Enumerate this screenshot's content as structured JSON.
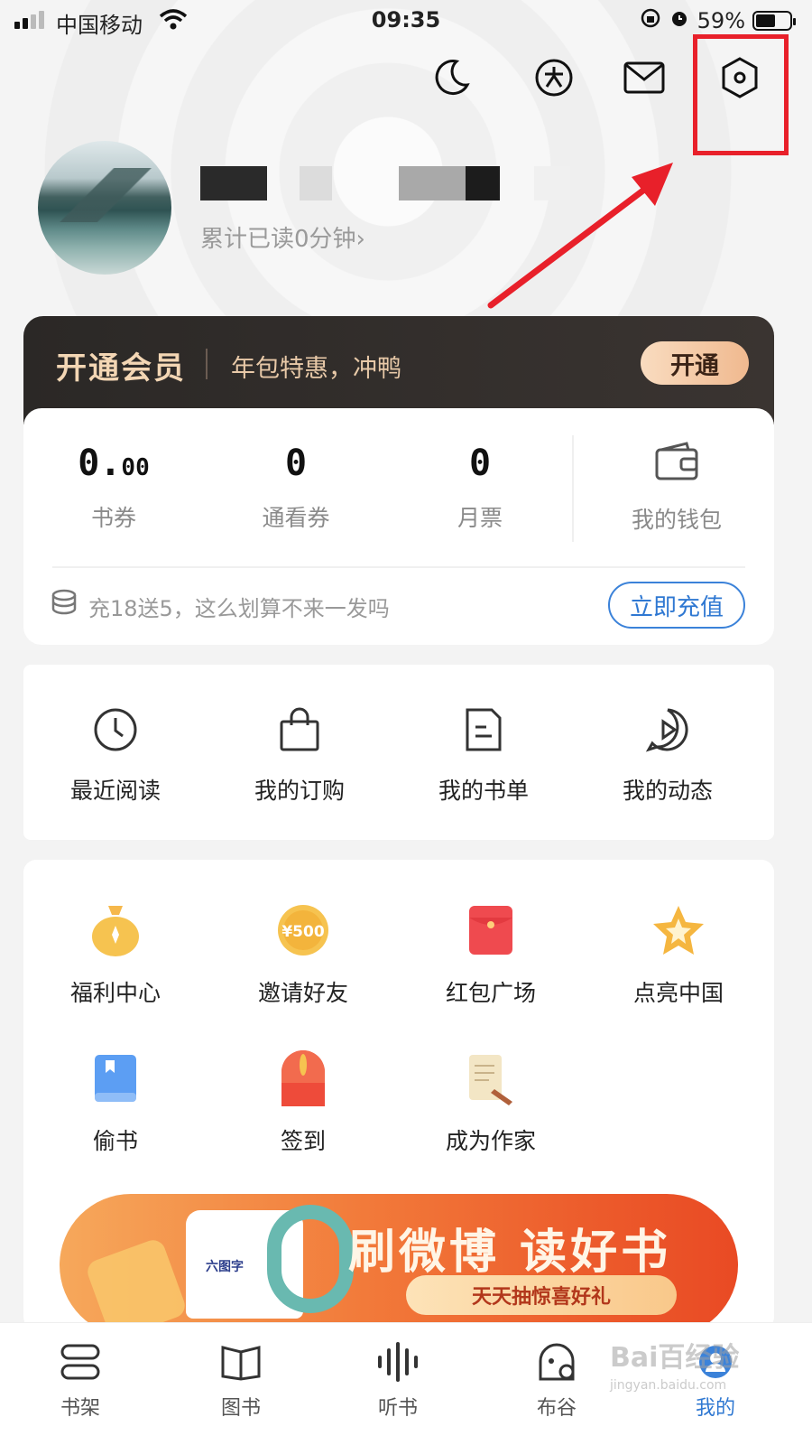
{
  "status_bar": {
    "carrier": "中国移动",
    "time": "09:35",
    "battery": "59%",
    "battery_level": 0.59
  },
  "header": {
    "icons": [
      "moon-icon",
      "pace-icon",
      "mail-icon",
      "settings-icon"
    ]
  },
  "profile": {
    "read_time": "累计已读0分钟",
    "chevron": "›"
  },
  "vip": {
    "title": "开通会员",
    "subtitle": "年包特惠，冲鸭",
    "button": "开通",
    "colors": {
      "title": "#f3d6b4",
      "background": "#2b2826"
    }
  },
  "wallet": {
    "stats": [
      {
        "value": "0.",
        "value_small": "00",
        "label": "书券"
      },
      {
        "value": "0",
        "label": "通看券"
      },
      {
        "value": "0",
        "label": "月票"
      }
    ],
    "wallet_label": "我的钱包",
    "promo": "充18送5，这么划算不来一发吗",
    "recharge_button": "立即充值"
  },
  "shortcuts": [
    {
      "label": "最近阅读",
      "icon": "clock-icon"
    },
    {
      "label": "我的订购",
      "icon": "shopping-bag-icon"
    },
    {
      "label": "我的书单",
      "icon": "document-icon"
    },
    {
      "label": "我的动态",
      "icon": "play-bubble-icon"
    }
  ],
  "features": [
    {
      "label": "福利中心",
      "icon": "money-bag-icon"
    },
    {
      "label": "邀请好友",
      "icon": "coin-500-icon",
      "icon_text": "¥500"
    },
    {
      "label": "红包广场",
      "icon": "red-envelope-icon"
    },
    {
      "label": "点亮中国",
      "icon": "star-icon"
    },
    {
      "label": "偷书",
      "icon": "book-icon"
    },
    {
      "label": "签到",
      "icon": "checkin-icon"
    },
    {
      "label": "成为作家",
      "icon": "scroll-pen-icon"
    }
  ],
  "banner": {
    "headline": "刷微博 读好书",
    "tagline": "天天抽惊喜好礼",
    "shirt_text": "六图字"
  },
  "tabbar": [
    {
      "label": "书架",
      "icon": "bookshelf-icon"
    },
    {
      "label": "图书",
      "icon": "open-book-icon"
    },
    {
      "label": "听书",
      "icon": "soundwave-icon"
    },
    {
      "label": "布谷",
      "icon": "bird-icon"
    },
    {
      "label": "我的",
      "icon": "profile-icon",
      "active": true
    }
  ],
  "watermark": {
    "text": "Bai百经验",
    "sub": "jingyan.baidu.com"
  },
  "accent": "#2f78d2",
  "highlight_color": "#e8202a"
}
